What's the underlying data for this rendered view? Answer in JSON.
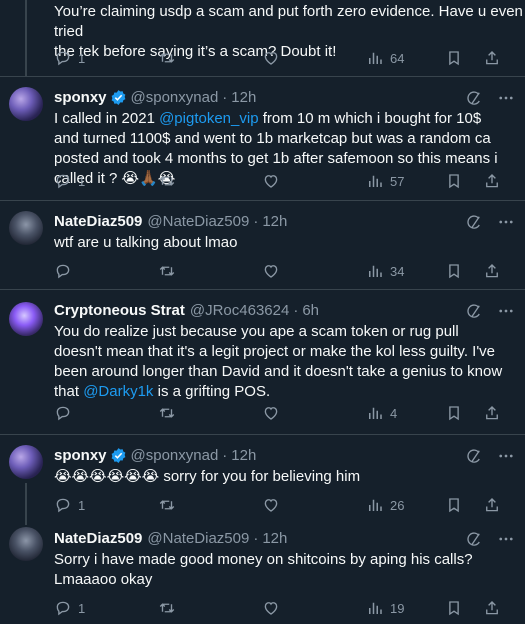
{
  "top_tweet": {
    "text_line1": "You’re claiming usdp a scam and put forth zero evidence. Have u even tried",
    "text_line2": "the tek before saying it’s a scam? Doubt it!",
    "replies": "1",
    "views": "64"
  },
  "tweets": [
    {
      "name": "sponxy",
      "handle": "@sponxynad",
      "time": "12h",
      "text_pre": "I called in 2021 ",
      "mention": "@pigtoken_vip",
      "text_post": "  from 10 m which i bought for 10$ and turned 1100$ and went to 1b marketcap but was a random ca posted and took 4 months to get 1b after safemoon so this means i called it ? 😭🙏🏾😭",
      "replies": "1",
      "views": "57"
    },
    {
      "name": "NateDiaz509",
      "handle": "@NateDiaz509",
      "time": "12h",
      "text": "wtf are u talking about lmao",
      "replies": "",
      "views": "34"
    },
    {
      "name": "Cryptoneous Strat",
      "handle": "@JRoc463624",
      "time": "6h",
      "text_pre": "You do realize just because you ape a scam token or rug pull doesn't mean that it's a legit project or make the kol less guilty. I've been around longer than David and it doesn't take a genius to know that ",
      "mention": "@Darky1k",
      "text_post": " is a grifting POS.",
      "replies": "",
      "views": "4"
    },
    {
      "name": "sponxy",
      "handle": "@sponxynad",
      "time": "12h",
      "text": "😭😭😭😭😭😭 sorry for you for believing him",
      "replies": "1",
      "views": "26"
    },
    {
      "name": "NateDiaz509",
      "handle": "@NateDiaz509",
      "time": "12h",
      "text": "Sorry i have made good money on shitcoins by aping his calls? Lmaaaoo okay",
      "replies": "1",
      "views": "19"
    }
  ],
  "colors": {
    "background": "#15202b",
    "text": "#f7f9f9",
    "muted": "#8b98a5",
    "accent": "#1d9bf0",
    "border": "#38444d"
  }
}
